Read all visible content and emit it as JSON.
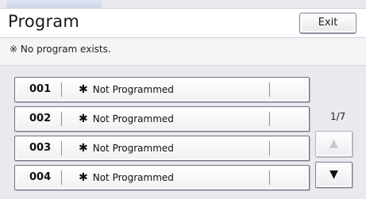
{
  "header": {
    "title": "Program",
    "exit_label": "Exit"
  },
  "message": "※ No program exists.",
  "programs": [
    {
      "number": "001",
      "star": "✱",
      "label": "Not Programmed"
    },
    {
      "number": "002",
      "star": "✱",
      "label": "Not Programmed"
    },
    {
      "number": "003",
      "star": "✱",
      "label": "Not Programmed"
    },
    {
      "number": "004",
      "star": "✱",
      "label": "Not Programmed"
    }
  ],
  "pager": {
    "text": "1/7",
    "up_icon": "▲",
    "down_icon": "▼"
  }
}
